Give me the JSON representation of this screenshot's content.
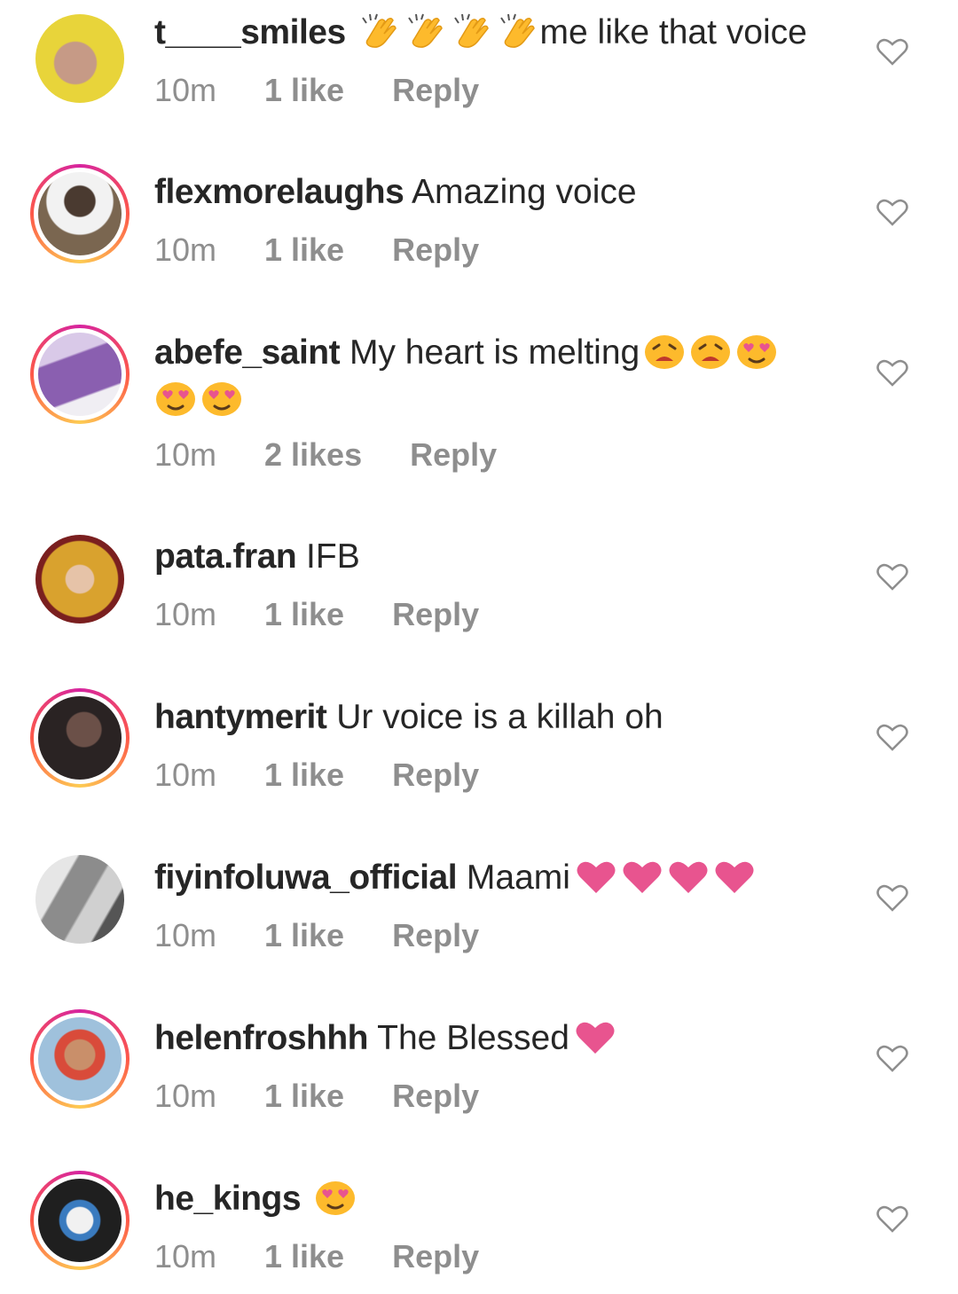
{
  "colors": {
    "username": "#262626",
    "meta": "#8e8e8e",
    "heart_outline": "#8e8e8e",
    "heart_emoji": "#e8548f",
    "emoji_yellow": "#fdba2c",
    "story_ring": [
      "#d6249f",
      "#fd5949",
      "#fdcb52"
    ]
  },
  "comments": [
    {
      "username": "t____smiles",
      "text": "",
      "text_after_emoji": "me like that voice",
      "emoji": [
        "clapping-hands",
        "clapping-hands",
        "clapping-hands",
        "clapping-hands"
      ],
      "time": "10m",
      "likes": "1 like",
      "reply": "Reply",
      "story_ring": false,
      "avatar_color": "#e8d43a"
    },
    {
      "username": "flexmorelaughs",
      "text": "Amazing voice",
      "emoji": [],
      "time": "10m",
      "likes": "1 like",
      "reply": "Reply",
      "story_ring": true,
      "avatar_color": "#6b5a48"
    },
    {
      "username": "abefe_saint",
      "text": "My heart is melting",
      "emoji": [
        "tired-face",
        "tired-face",
        "heart-eyes",
        "heart-eyes",
        "heart-eyes"
      ],
      "time": "10m",
      "likes": "2 likes",
      "reply": "Reply",
      "story_ring": true,
      "avatar_color": "#8a5fb0"
    },
    {
      "username": "pata.fran",
      "text": "IFB",
      "emoji": [],
      "time": "10m",
      "likes": "1 like",
      "reply": "Reply",
      "story_ring": false,
      "avatar_color": "#b88a2a"
    },
    {
      "username": "hantymerit",
      "text": "Ur voice is a killah oh",
      "emoji": [],
      "time": "10m",
      "likes": "1 like",
      "reply": "Reply",
      "story_ring": true,
      "avatar_color": "#3a3232"
    },
    {
      "username": "fiyinfoluwa_official",
      "text": "Maami",
      "emoji": [
        "pink-heart",
        "pink-heart",
        "pink-heart",
        "pink-heart"
      ],
      "time": "10m",
      "likes": "1 like",
      "reply": "Reply",
      "story_ring": false,
      "avatar_color": "#9a9a9a"
    },
    {
      "username": "helenfroshhh",
      "text": "The Blessed",
      "emoji": [
        "pink-heart"
      ],
      "time": "10m",
      "likes": "1 like",
      "reply": "Reply",
      "story_ring": true,
      "avatar_color": "#7fa3c4"
    },
    {
      "username": "he_kings",
      "text": "",
      "emoji": [
        "heart-eyes"
      ],
      "time": "10m",
      "likes": "1 like",
      "reply": "Reply",
      "story_ring": true,
      "avatar_color": "#1f1f1f"
    }
  ]
}
